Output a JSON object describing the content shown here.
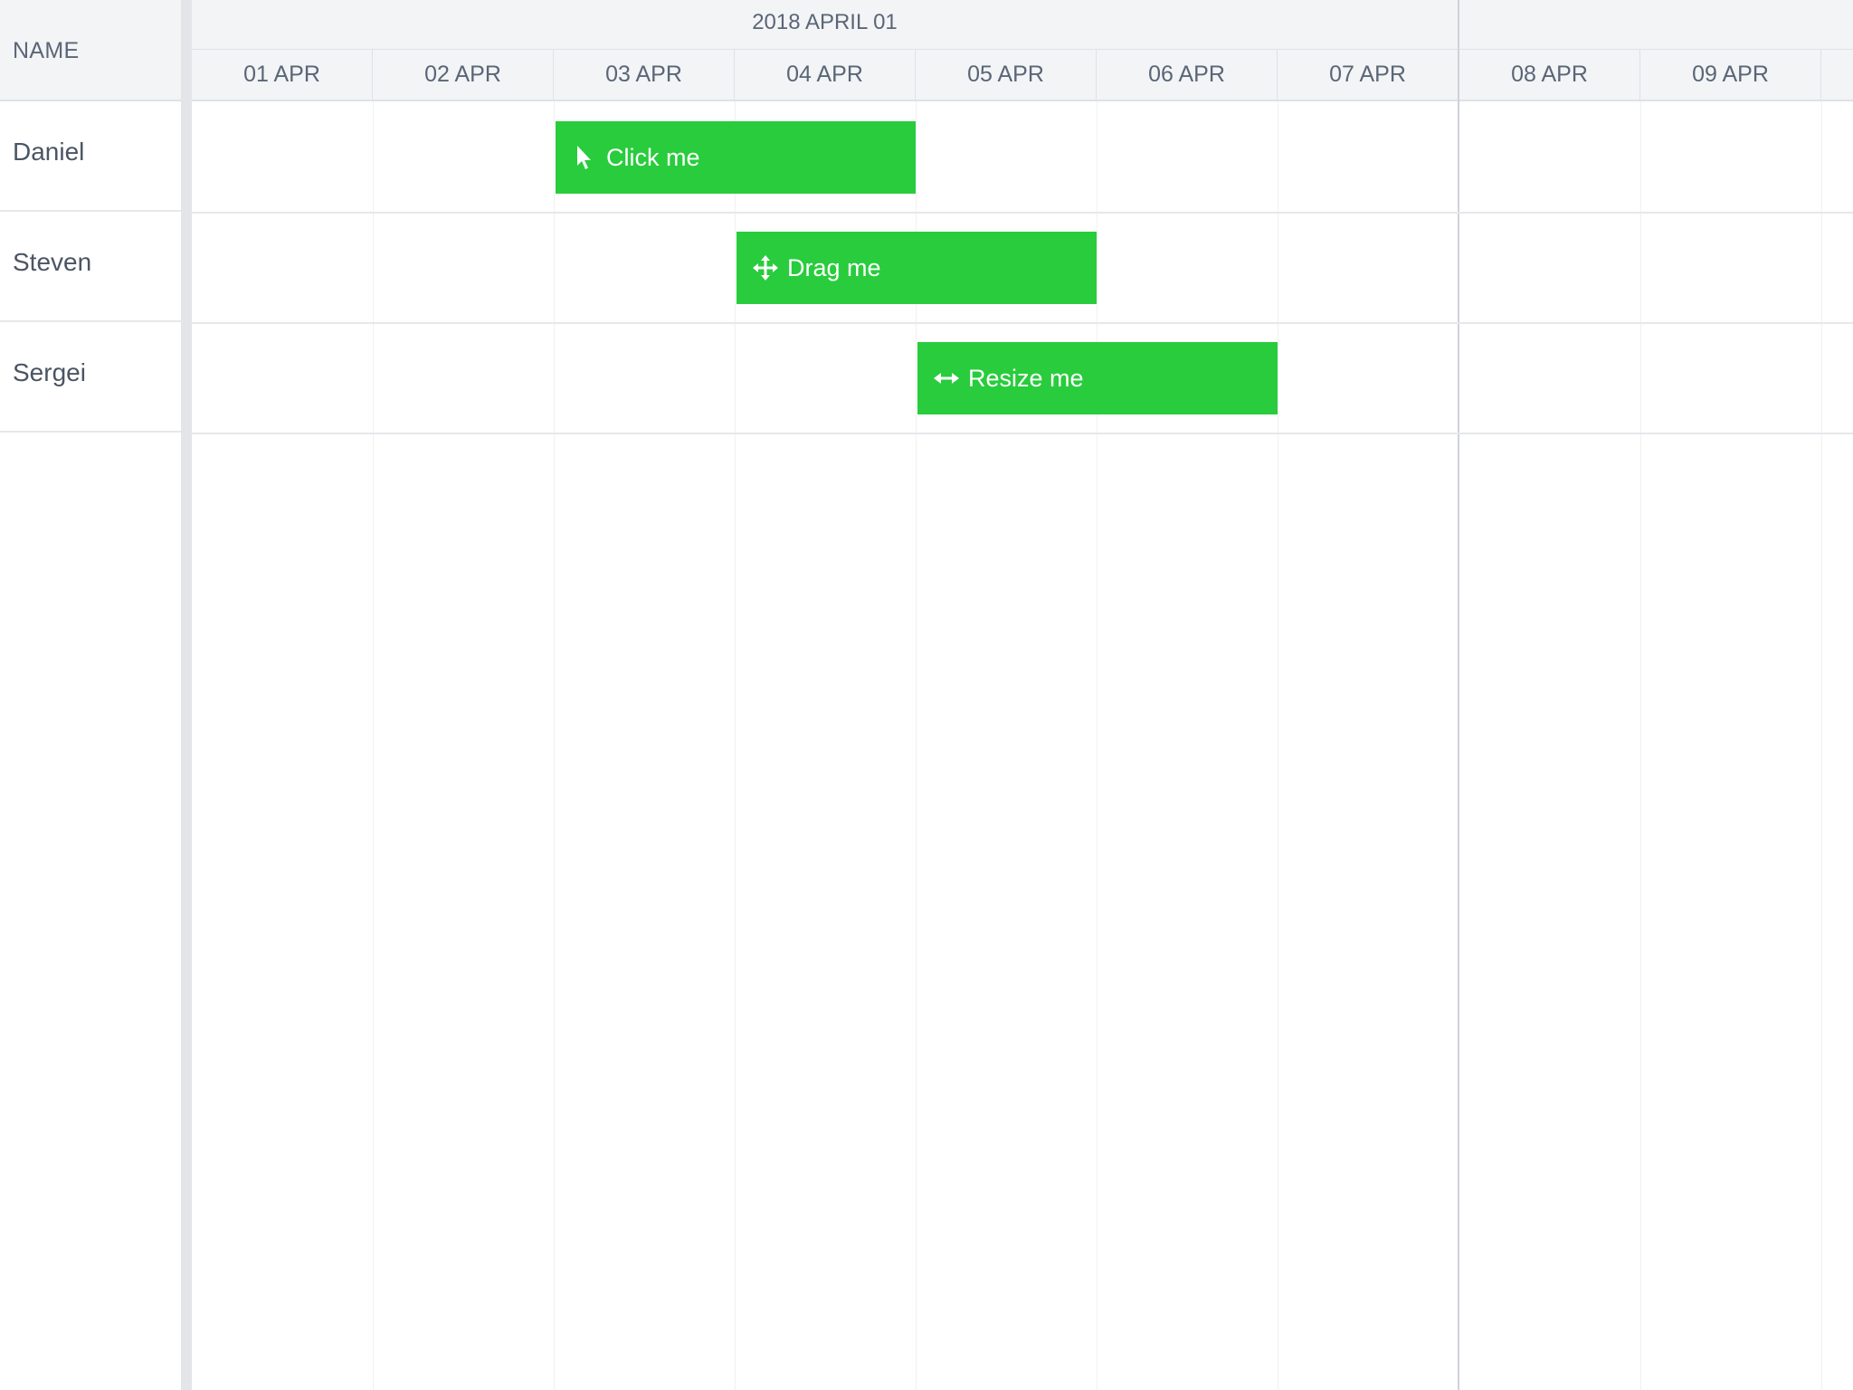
{
  "name_column": {
    "header": "NAME"
  },
  "resources": [
    {
      "name": "Daniel"
    },
    {
      "name": "Steven"
    },
    {
      "name": "Sergei"
    }
  ],
  "timeaxis": {
    "week_label": "2018 APRIL 01",
    "days": [
      "01 APR",
      "02 APR",
      "03 APR",
      "04 APR",
      "05 APR",
      "06 APR",
      "07 APR",
      "08 APR",
      "09 APR"
    ]
  },
  "events": [
    {
      "label": "Click me",
      "icon": "pointer-icon",
      "resource": "Daniel",
      "start": "03 APR",
      "end": "04 APR"
    },
    {
      "label": "Drag me",
      "icon": "move-arrows-icon",
      "resource": "Steven",
      "start": "04 APR",
      "end": "05 APR"
    },
    {
      "label": "Resize me",
      "icon": "resize-arrows-icon",
      "resource": "Sergei",
      "start": "05 APR",
      "end": "06 APR"
    }
  ],
  "colors": {
    "event": "#28cc3c",
    "header_bg": "#f3f4f6",
    "splitter": "#e4e5e8",
    "text": "#4b5563"
  }
}
